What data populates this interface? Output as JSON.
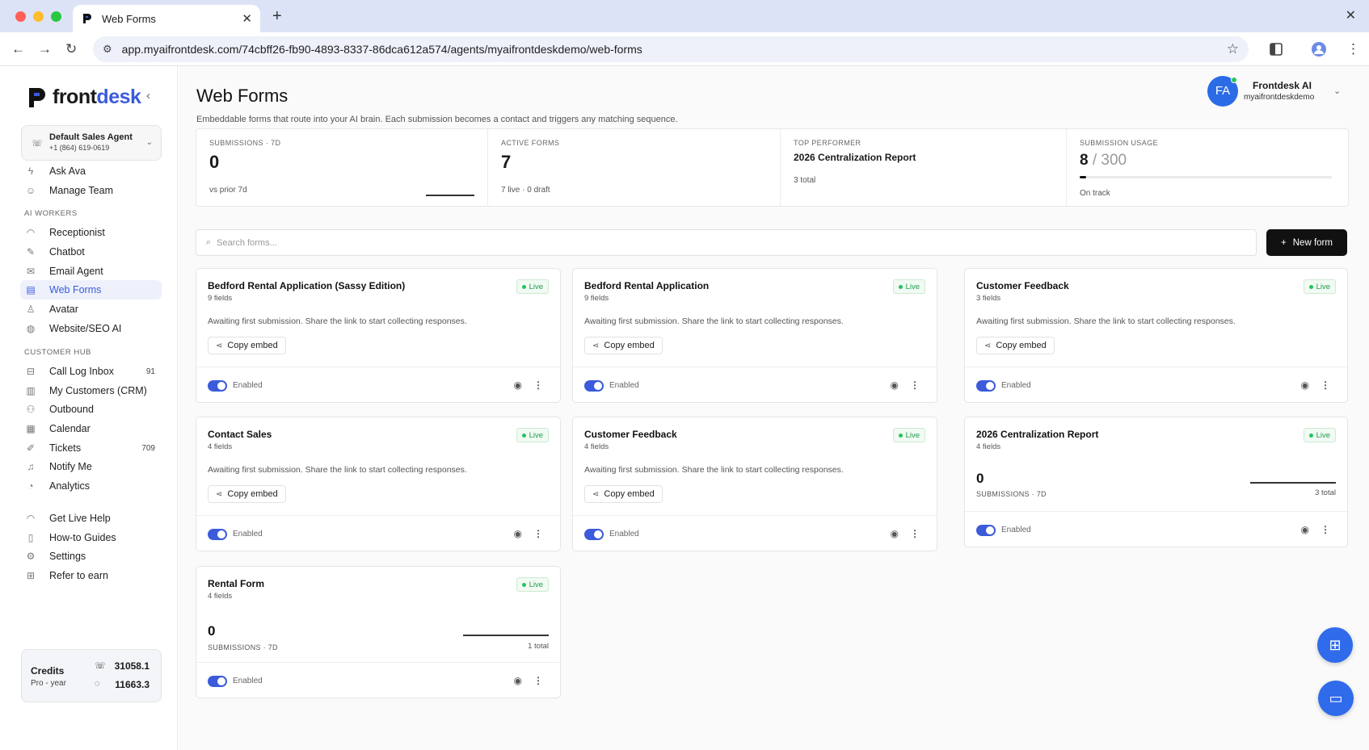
{
  "browser": {
    "tab_title": "Web Forms",
    "url": "app.myaifrontdesk.com/74cbff26-fb90-4893-8337-86dca612a574/agents/myaifrontdeskdemo/web-forms"
  },
  "sidebar": {
    "logo_front": "front",
    "logo_desk": "desk",
    "agent_name": "Default Sales Agent",
    "agent_phone": "+1 (864) 619-0619",
    "top_items": [
      {
        "label": "Ask Ava",
        "icon": "bolt-icon"
      },
      {
        "label": "Manage Team",
        "icon": "team-icon"
      }
    ],
    "section_ai": "AI WORKERS",
    "ai_items": [
      {
        "label": "Receptionist",
        "icon": "headset-icon"
      },
      {
        "label": "Chatbot",
        "icon": "chatbot-icon"
      },
      {
        "label": "Email Agent",
        "icon": "mail-icon"
      },
      {
        "label": "Web Forms",
        "icon": "form-icon",
        "active": true
      },
      {
        "label": "Avatar",
        "icon": "person-icon"
      },
      {
        "label": "Website/SEO AI",
        "icon": "globe-icon"
      }
    ],
    "section_hub": "CUSTOMER HUB",
    "hub_items": [
      {
        "label": "Call Log Inbox",
        "icon": "inbox-icon",
        "count": "91"
      },
      {
        "label": "My Customers (CRM)",
        "icon": "chart-icon"
      },
      {
        "label": "Outbound",
        "icon": "outbound-icon"
      },
      {
        "label": "Calendar",
        "icon": "calendar-icon"
      },
      {
        "label": "Tickets",
        "icon": "ticket-icon",
        "count": "709"
      },
      {
        "label": "Notify Me",
        "icon": "bell-icon"
      },
      {
        "label": "Analytics",
        "icon": "pie-icon"
      }
    ],
    "bottom_items": [
      {
        "label": "Get Live Help",
        "icon": "help-headset-icon"
      },
      {
        "label": "How-to Guides",
        "icon": "book-icon"
      },
      {
        "label": "Settings",
        "icon": "gear-icon"
      },
      {
        "label": "Refer to earn",
        "icon": "gift-icon"
      }
    ],
    "credits_title": "Credits",
    "credits_plan": "Pro - year",
    "credits_calls": "31058.1",
    "credits_chats": "11663.3"
  },
  "header": {
    "title": "Web Forms",
    "subtitle": "Embeddable forms that route into your AI brain. Each submission becomes a contact and triggers any matching sequence.",
    "user_initials": "FA",
    "user_name": "Frontdesk AI",
    "user_handle": "myaifrontdeskdemo"
  },
  "stats": {
    "submissions_label": "SUBMISSIONS · 7D",
    "submissions_value": "0",
    "submissions_note": "vs prior 7d",
    "active_label": "ACTIVE FORMS",
    "active_value": "7",
    "active_note": "7 live · 0 draft",
    "top_label": "TOP PERFORMER",
    "top_value": "2026 Centralization Report",
    "top_note": "3 total",
    "usage_label": "SUBMISSION USAGE",
    "usage_used": "8",
    "usage_total": "/ 300",
    "usage_fraction": 0.027,
    "usage_note": "On track"
  },
  "toolbar": {
    "search_placeholder": "Search forms...",
    "new_form_label": "New form"
  },
  "common": {
    "live": "Live",
    "awaiting": "Awaiting first submission. Share the link to start collecting responses.",
    "copy_embed": "Copy embed",
    "enabled": "Enabled",
    "submissions_7d": "SUBMISSIONS · 7D"
  },
  "forms": [
    {
      "title": "Bedford Rental Application (Sassy Edition)",
      "fields": "9 fields"
    },
    {
      "title": "Bedford Rental Application",
      "fields": "9 fields"
    },
    {
      "title": "Customer Feedback",
      "fields": "3 fields"
    },
    {
      "title": "Contact Sales",
      "fields": "4 fields"
    },
    {
      "title": "Customer Feedback",
      "fields": "4 fields"
    },
    {
      "title": "2026 Centralization Report",
      "fields": "4 fields",
      "submissions": "0",
      "total": "3 total"
    },
    {
      "title": "Rental Form",
      "fields": "4 fields",
      "submissions": "0",
      "total": "1 total"
    }
  ]
}
